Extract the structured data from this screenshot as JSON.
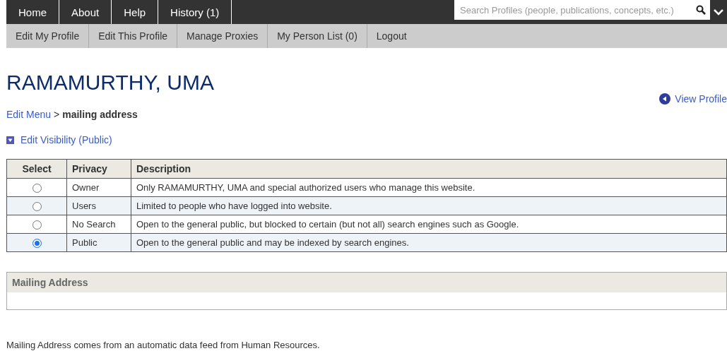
{
  "top_nav": [
    "Home",
    "About",
    "Help",
    "History (1)"
  ],
  "search": {
    "placeholder": "Search Profiles (people, publications, concepts, etc.)"
  },
  "sub_nav": [
    "Edit My Profile",
    "Edit This Profile",
    "Manage Proxies",
    "My Person List (0)",
    "Logout"
  ],
  "title": "RAMAMURTHY, UMA",
  "view_profile": "View Profile",
  "breadcrumb": {
    "link": "Edit Menu",
    "separator": ">",
    "current": "mailing address"
  },
  "visibility_toggle": {
    "label": "Edit Visibility (Public)",
    "expanded": true
  },
  "table": {
    "columns": [
      "Select",
      "Privacy",
      "Description"
    ],
    "rows": [
      {
        "privacy": "Owner",
        "description": "Only RAMAMURTHY, UMA and special authorized users who manage this website.",
        "selected": false
      },
      {
        "privacy": "Users",
        "description": "Limited to people who have logged into website.",
        "selected": false
      },
      {
        "privacy": "No Search",
        "description": "Open to the general public, but blocked to certain (but not all) search engines such as Google.",
        "selected": false
      },
      {
        "privacy": "Public",
        "description": "Open to the general public and may be indexed by search engines.",
        "selected": true
      }
    ]
  },
  "section": {
    "title": "Mailing Address"
  },
  "note": "Mailing Address comes from an automatic data feed from Human Resources."
}
